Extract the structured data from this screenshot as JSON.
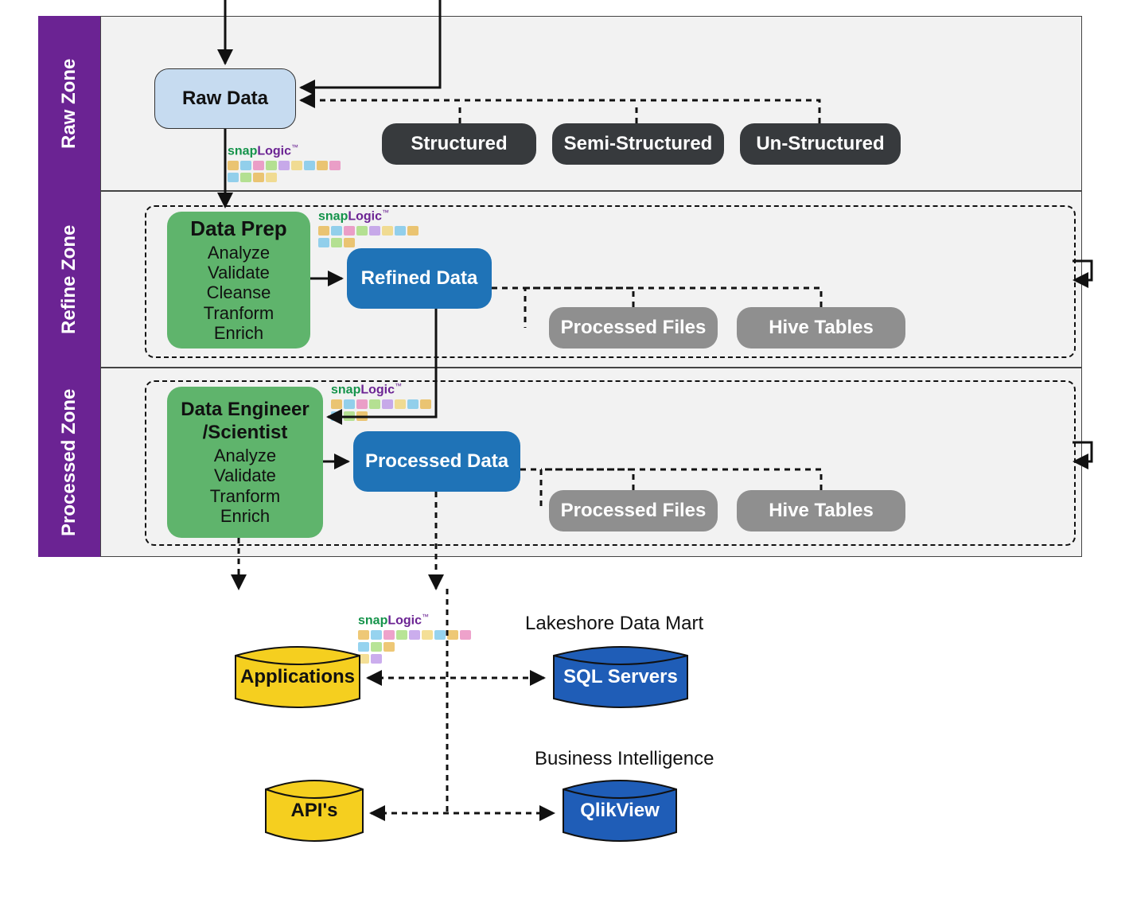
{
  "zones": {
    "raw": {
      "label": "Raw Zone"
    },
    "refine": {
      "label": "Refine Zone"
    },
    "processed": {
      "label": "Processed Zone"
    }
  },
  "raw": {
    "raw_data": "Raw Data",
    "types": {
      "structured": "Structured",
      "semi": "Semi-Structured",
      "un": "Un-Structured"
    }
  },
  "refine": {
    "prep": {
      "title": "Data Prep",
      "steps": {
        "analyze": "Analyze",
        "validate": "Validate",
        "cleanse": "Cleanse",
        "transform": "Tranform",
        "enrich": "Enrich"
      }
    },
    "refined_data": "Refined Data",
    "outputs": {
      "files": "Processed Files",
      "hive": "Hive Tables"
    }
  },
  "processed": {
    "eng": {
      "title1": "Data Engineer",
      "title2": "/Scientist",
      "steps": {
        "analyze": "Analyze",
        "validate": "Validate",
        "transform": "Tranform",
        "enrich": "Enrich"
      }
    },
    "processed_data": "Processed Data",
    "outputs": {
      "files": "Processed Files",
      "hive": "Hive Tables"
    }
  },
  "consumers": {
    "lakeshore_title": "Lakeshore Data Mart",
    "bi_title": "Business Intelligence",
    "applications": "Applications",
    "apis": "API's",
    "sql": "SQL Servers",
    "qlik": "QlikView"
  },
  "snaplogic": {
    "snap": "snap",
    "logic": "Logic"
  },
  "colors": {
    "purple": "#6b2393",
    "green_block": "#5fb46c",
    "blue_block": "#1f73b7",
    "dark_block": "#373a3d",
    "grey_block": "#8f8f8f",
    "lightblue_block": "#c6dbf0",
    "cyl_yellow": "#f5cf1f",
    "cyl_blue": "#1f5db7"
  }
}
